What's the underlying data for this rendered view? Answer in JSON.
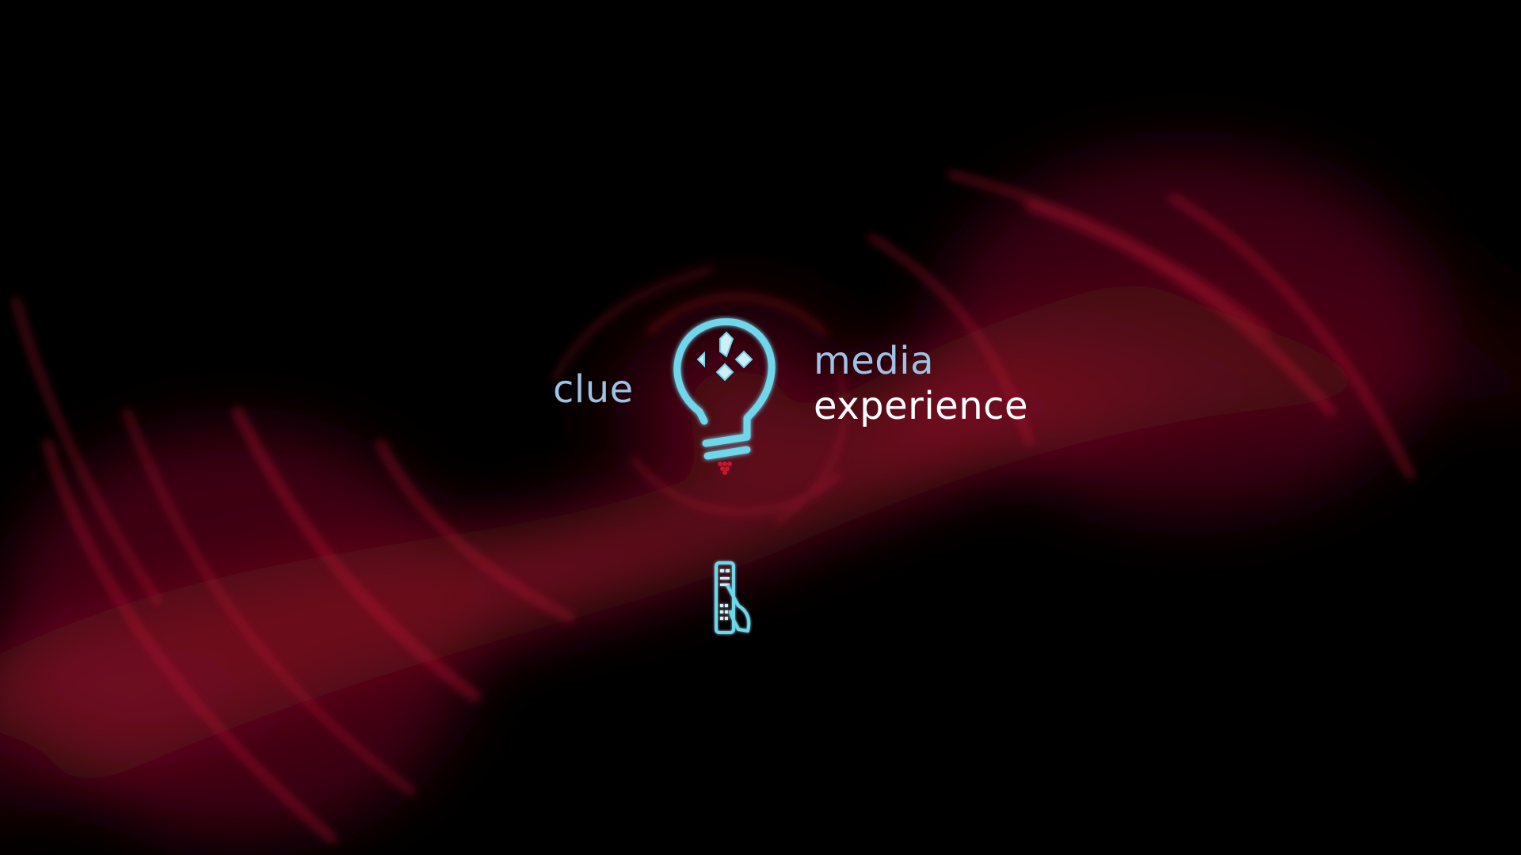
{
  "splash": {
    "brand_left": "clue",
    "brand_right_top": "media",
    "brand_right_bottom": "experience"
  },
  "icons": {
    "logo": "lightbulb-logo-icon",
    "raspberry": "raspberry-icon",
    "remote": "remote-hand-icon"
  },
  "colors": {
    "background": "#000000",
    "swirl": "#b0102e",
    "accent_blue": "#9ec1e4",
    "glow_cyan": "#6fd6ea",
    "text_white": "#ffffff"
  }
}
